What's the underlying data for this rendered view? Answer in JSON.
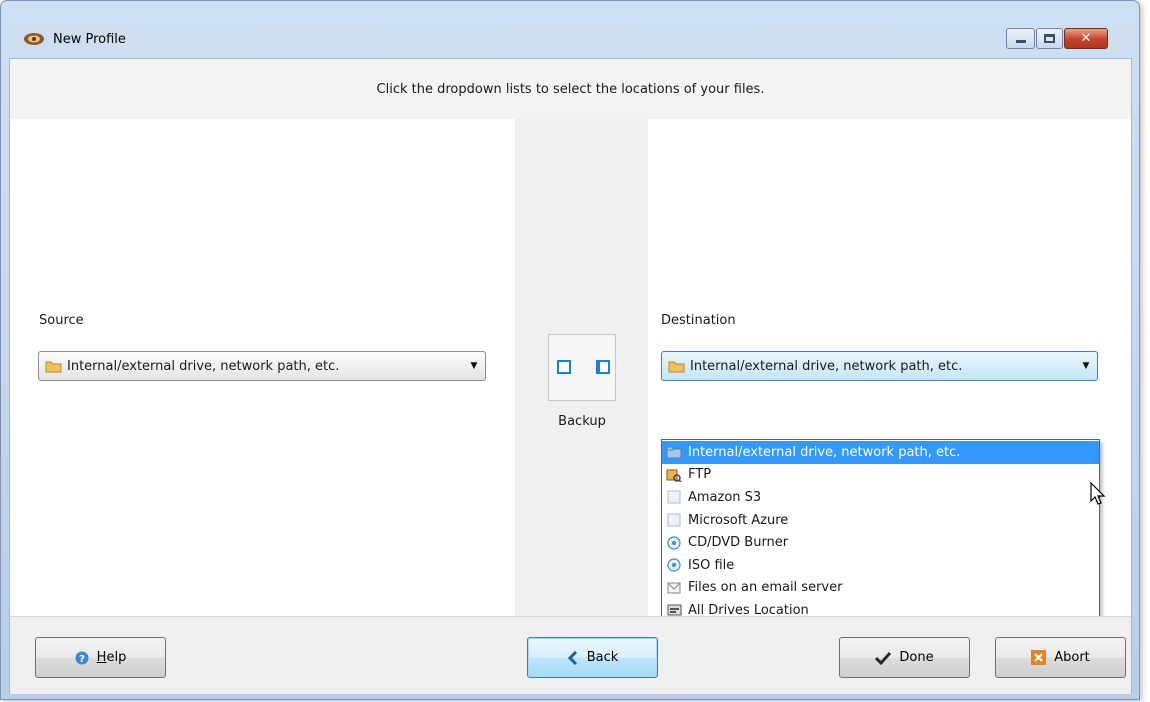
{
  "window": {
    "title": "New Profile",
    "controls": {
      "minimize": "minimize",
      "maximize": "maximize",
      "close": "✕"
    }
  },
  "header": {
    "instruction": "Click the dropdown lists to select the locations of your files."
  },
  "source": {
    "label": "Source",
    "selected": "Internal/external drive, network path, etc.",
    "icon": "folder-icon"
  },
  "destination": {
    "label": "Destination",
    "selected": "Internal/external drive, network path, etc.",
    "icon": "folder-icon",
    "options": [
      {
        "label": "Internal/external drive, network path, etc.",
        "icon": "drive-icon",
        "selected": true
      },
      {
        "label": "FTP",
        "icon": "ftp-icon"
      },
      {
        "label": "Amazon S3",
        "icon": "cloud-icon"
      },
      {
        "label": "Microsoft Azure",
        "icon": "cloud-icon"
      },
      {
        "label": "CD/DVD Burner",
        "icon": "disc-icon"
      },
      {
        "label": "ISO file",
        "icon": "disc-icon"
      },
      {
        "label": "Files on an email server",
        "icon": "email-icon"
      },
      {
        "label": "All Drives Location",
        "icon": "drives-icon"
      }
    ]
  },
  "mode": {
    "label": "Backup"
  },
  "buttons": {
    "help": {
      "prefix": "",
      "accel": "H",
      "rest": "elp"
    },
    "back": "Back",
    "done": "Done",
    "abort": "Abort"
  },
  "colors": {
    "selection": "#3399ff",
    "accent": "#1f7fd6",
    "abort": "#e8821e"
  }
}
